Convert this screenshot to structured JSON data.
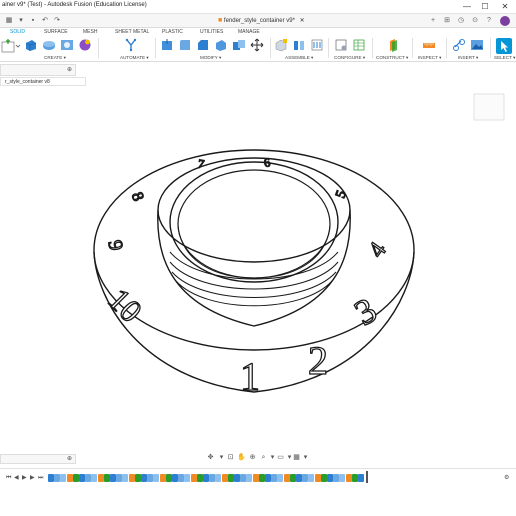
{
  "window": {
    "title": "ainer v9* (Test) - Autodesk Fusion (Education License)",
    "minimize": "—",
    "maximize": "☐",
    "close": "✕"
  },
  "tabstrip": {
    "doc_tab": "fender_style_container v9*",
    "doc_icon": "■",
    "close": "✕",
    "add": "+"
  },
  "ribbon_tabs": [
    "SOLID",
    "SURFACE",
    "MESH",
    "SHEET METAL",
    "PLASTIC",
    "UTILITIES",
    "MANAGE"
  ],
  "ribbon_active_tab": "SOLID",
  "ribbon_groups": [
    "CREATE ▾",
    "AUTOMATE ▾",
    "MODIFY ▾",
    "ASSEMBLE ▾",
    "CONFIGURE ▾",
    "CONSTRUCT ▾",
    "INSPECT ▾",
    "INSERT ▾",
    "SELECT ▾"
  ],
  "browser": {
    "label": "",
    "close": "⊕",
    "breadcrumb": "r_style_container v8"
  },
  "comments": {
    "label": "",
    "close": "⊕"
  },
  "model": {
    "numbers": [
      "1",
      "2",
      "3",
      "4",
      "5",
      "6",
      "7",
      "8",
      "9",
      "10"
    ]
  },
  "colors": {
    "accent": "#0696d7",
    "select": "#0696d7",
    "orange": "#f08a24"
  }
}
